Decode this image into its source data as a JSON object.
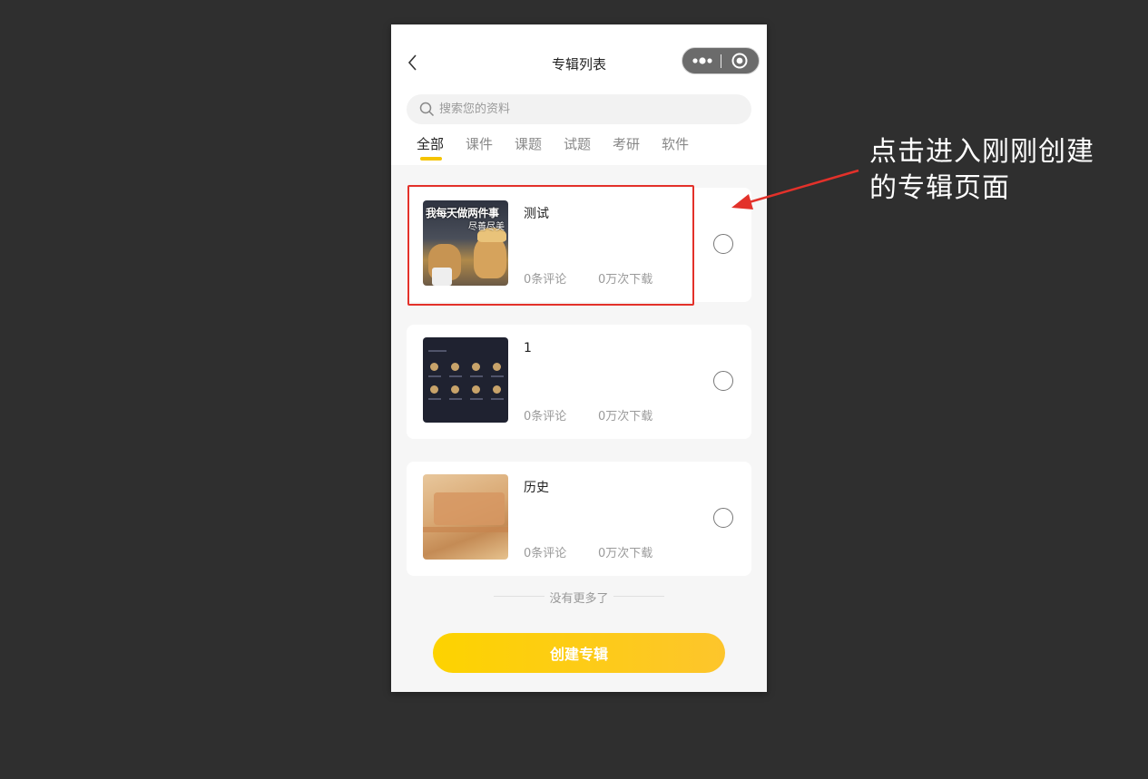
{
  "header": {
    "title": "专辑列表"
  },
  "search": {
    "placeholder": "搜索您的资料",
    "value": ""
  },
  "tabs": [
    {
      "label": "全部",
      "active": true
    },
    {
      "label": "课件",
      "active": false
    },
    {
      "label": "课题",
      "active": false
    },
    {
      "label": "试题",
      "active": false
    },
    {
      "label": "考研",
      "active": false
    },
    {
      "label": "软件",
      "active": false
    }
  ],
  "albums": [
    {
      "title": "测试",
      "comments": "0条评论",
      "downloads": "0万次下载",
      "thumbnail_text": [
        "我每天做两件事",
        "尽善尽美"
      ],
      "selected": false
    },
    {
      "title": "1",
      "comments": "0条评论",
      "downloads": "0万次下载",
      "selected": false
    },
    {
      "title": "历史",
      "comments": "0条评论",
      "downloads": "0万次下载",
      "selected": false
    }
  ],
  "footer": {
    "no_more": "没有更多了",
    "create_button": "创建专辑"
  },
  "annotation": {
    "lines": [
      "点击进入刚刚创建",
      "的专辑页面"
    ],
    "color": "#e3312a"
  },
  "colors": {
    "accent": "#f5c400",
    "button_gradient_start": "#fdd300",
    "button_gradient_end": "#fdc52c",
    "desktop_background": "#2f2f2f"
  }
}
